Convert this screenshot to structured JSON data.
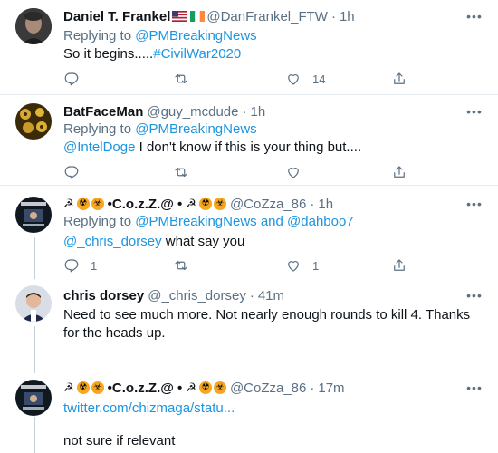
{
  "tweets": [
    {
      "name": "Daniel T. Frankel",
      "handle": "@DanFrankel_FTW",
      "dot": "·",
      "time": "1h",
      "replying_prefix": "Replying to",
      "replying_to": "@PMBreakingNews",
      "text": "So it begins.....",
      "hashtag": "#CivilWar2020",
      "replies": "",
      "retweets": "",
      "likes": "14",
      "flags": [
        "us-flag",
        "ireland-flag"
      ]
    },
    {
      "name": "BatFaceMan",
      "handle": "@guy_mcdude",
      "dot": "·",
      "time": "1h",
      "replying_prefix": "Replying to",
      "replying_to": "@PMBreakingNews",
      "mention": "@IntelDoge",
      "text": " I don't know if this is your thing but....",
      "replies": "",
      "retweets": "",
      "likes": ""
    },
    {
      "name": "•C.o.z.Z.@ •",
      "handle": "@CoZza_86",
      "dot": "·",
      "time": "1h",
      "replying_prefix": "Replying to",
      "replying_to": "@PMBreakingNews",
      "replying_and": " and ",
      "replying_to_2": "@dahboo7",
      "mention": "@_chris_dorsey",
      "text": " what say you",
      "replies": "1",
      "retweets": "",
      "likes": "1"
    },
    {
      "name": "chris dorsey",
      "handle": "@_chris_dorsey",
      "dot": "·",
      "time": "41m",
      "text_line1": "Need to see much more.  Not nearly enough rounds to kill 4.  Thanks",
      "text_line2": "for the heads up."
    },
    {
      "name": "•C.o.z.Z.@ •",
      "handle": "@CoZza_86",
      "dot": "·",
      "time": "17m",
      "link": "twitter.com/chizmaga/statu...",
      "text": "not sure if relevant"
    }
  ],
  "more_label": "•••",
  "colors": {
    "link": "#1b95e0",
    "secondary": "#5b7083",
    "divider": "#e6ecf0",
    "thread": "#c4cfd6"
  }
}
